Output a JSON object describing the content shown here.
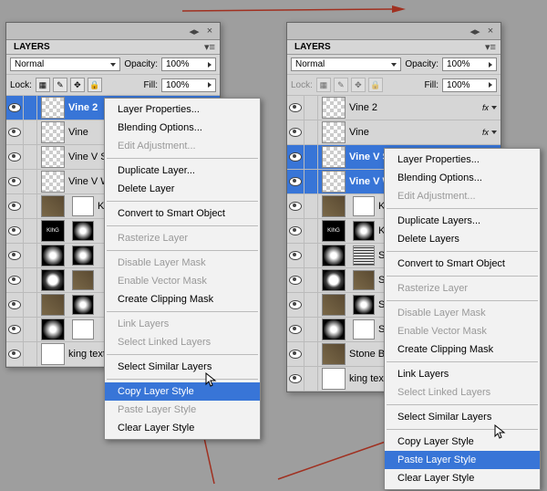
{
  "colors": {
    "highlight": "#3875d7",
    "arrow": "#a03020"
  },
  "panel_label": "LAYERS",
  "blend_mode": "Normal",
  "opacity_label": "Opacity:",
  "opacity_value": "100%",
  "fill_label": "Fill:",
  "fill_value": "100%",
  "lock_label": "Lock:",
  "left_panel": {
    "layers": [
      {
        "name": "Vine 2",
        "selected": true,
        "thumb": "checker"
      },
      {
        "name": "Vine",
        "thumb": "checker"
      },
      {
        "name": "Vine V Sh",
        "thumb": "checker"
      },
      {
        "name": "Vine V W",
        "thumb": "checker"
      },
      {
        "name": "King Text",
        "thumb": "texture",
        "mask": "white"
      },
      {
        "name": "",
        "thumb": "black",
        "mask": "radial",
        "text": "KIhG"
      },
      {
        "name": "",
        "thumb": "radial",
        "mask": "radial"
      },
      {
        "name": "",
        "thumb": "radial-dots",
        "mask": "texture"
      },
      {
        "name": "",
        "thumb": "texture",
        "mask": "radial"
      },
      {
        "name": "",
        "thumb": "radial",
        "mask": "white"
      },
      {
        "name": "king text",
        "thumb": "white"
      }
    ]
  },
  "right_panel": {
    "layers": [
      {
        "name": "Vine 2",
        "thumb": "checker",
        "fx": true
      },
      {
        "name": "Vine",
        "thumb": "checker",
        "fx": true
      },
      {
        "name": "Vine V Shear",
        "selected": true,
        "thumb": "checker"
      },
      {
        "name": "Vine V Wave",
        "selected": true,
        "thumb": "checker"
      },
      {
        "name": "King Text Sharp",
        "thumb": "texture",
        "mask": "white"
      },
      {
        "name": "King Sto",
        "thumb": "black",
        "mask": "radial",
        "text": "KIhG"
      },
      {
        "name": "Stone Ed",
        "thumb": "radial",
        "mask": "stripes"
      },
      {
        "name": "Stone C",
        "thumb": "radial-dots",
        "mask": "texture"
      },
      {
        "name": "Stone Blu",
        "thumb": "texture",
        "mask": "radial"
      },
      {
        "name": "Stone Sh",
        "thumb": "radial",
        "mask": "white"
      },
      {
        "name": "Stone Bg",
        "thumb": "texture"
      },
      {
        "name": "king text",
        "thumb": "white"
      }
    ]
  },
  "left_menu": [
    {
      "label": "Layer Properties..."
    },
    {
      "label": "Blending Options..."
    },
    {
      "label": "Edit Adjustment...",
      "disabled": true
    },
    {
      "sep": true
    },
    {
      "label": "Duplicate Layer..."
    },
    {
      "label": "Delete Layer"
    },
    {
      "sep": true
    },
    {
      "label": "Convert to Smart Object"
    },
    {
      "sep": true
    },
    {
      "label": "Rasterize Layer",
      "disabled": true
    },
    {
      "sep": true
    },
    {
      "label": "Disable Layer Mask",
      "disabled": true
    },
    {
      "label": "Enable Vector Mask",
      "disabled": true
    },
    {
      "label": "Create Clipping Mask"
    },
    {
      "sep": true
    },
    {
      "label": "Link Layers",
      "disabled": true
    },
    {
      "label": "Select Linked Layers",
      "disabled": true
    },
    {
      "sep": true
    },
    {
      "label": "Select Similar Layers"
    },
    {
      "sep": true
    },
    {
      "label": "Copy Layer Style",
      "hover": true
    },
    {
      "label": "Paste Layer Style",
      "disabled": true
    },
    {
      "label": "Clear Layer Style"
    }
  ],
  "right_menu": [
    {
      "label": "Layer Properties..."
    },
    {
      "label": "Blending Options..."
    },
    {
      "label": "Edit Adjustment...",
      "disabled": true
    },
    {
      "sep": true
    },
    {
      "label": "Duplicate Layers..."
    },
    {
      "label": "Delete Layers"
    },
    {
      "sep": true
    },
    {
      "label": "Convert to Smart Object"
    },
    {
      "sep": true
    },
    {
      "label": "Rasterize Layer",
      "disabled": true
    },
    {
      "sep": true
    },
    {
      "label": "Disable Layer Mask",
      "disabled": true
    },
    {
      "label": "Enable Vector Mask",
      "disabled": true
    },
    {
      "label": "Create Clipping Mask"
    },
    {
      "sep": true
    },
    {
      "label": "Link Layers"
    },
    {
      "label": "Select Linked Layers",
      "disabled": true
    },
    {
      "sep": true
    },
    {
      "label": "Select Similar Layers"
    },
    {
      "sep": true
    },
    {
      "label": "Copy Layer Style"
    },
    {
      "label": "Paste Layer Style",
      "hover": true
    },
    {
      "label": "Clear Layer Style"
    }
  ]
}
